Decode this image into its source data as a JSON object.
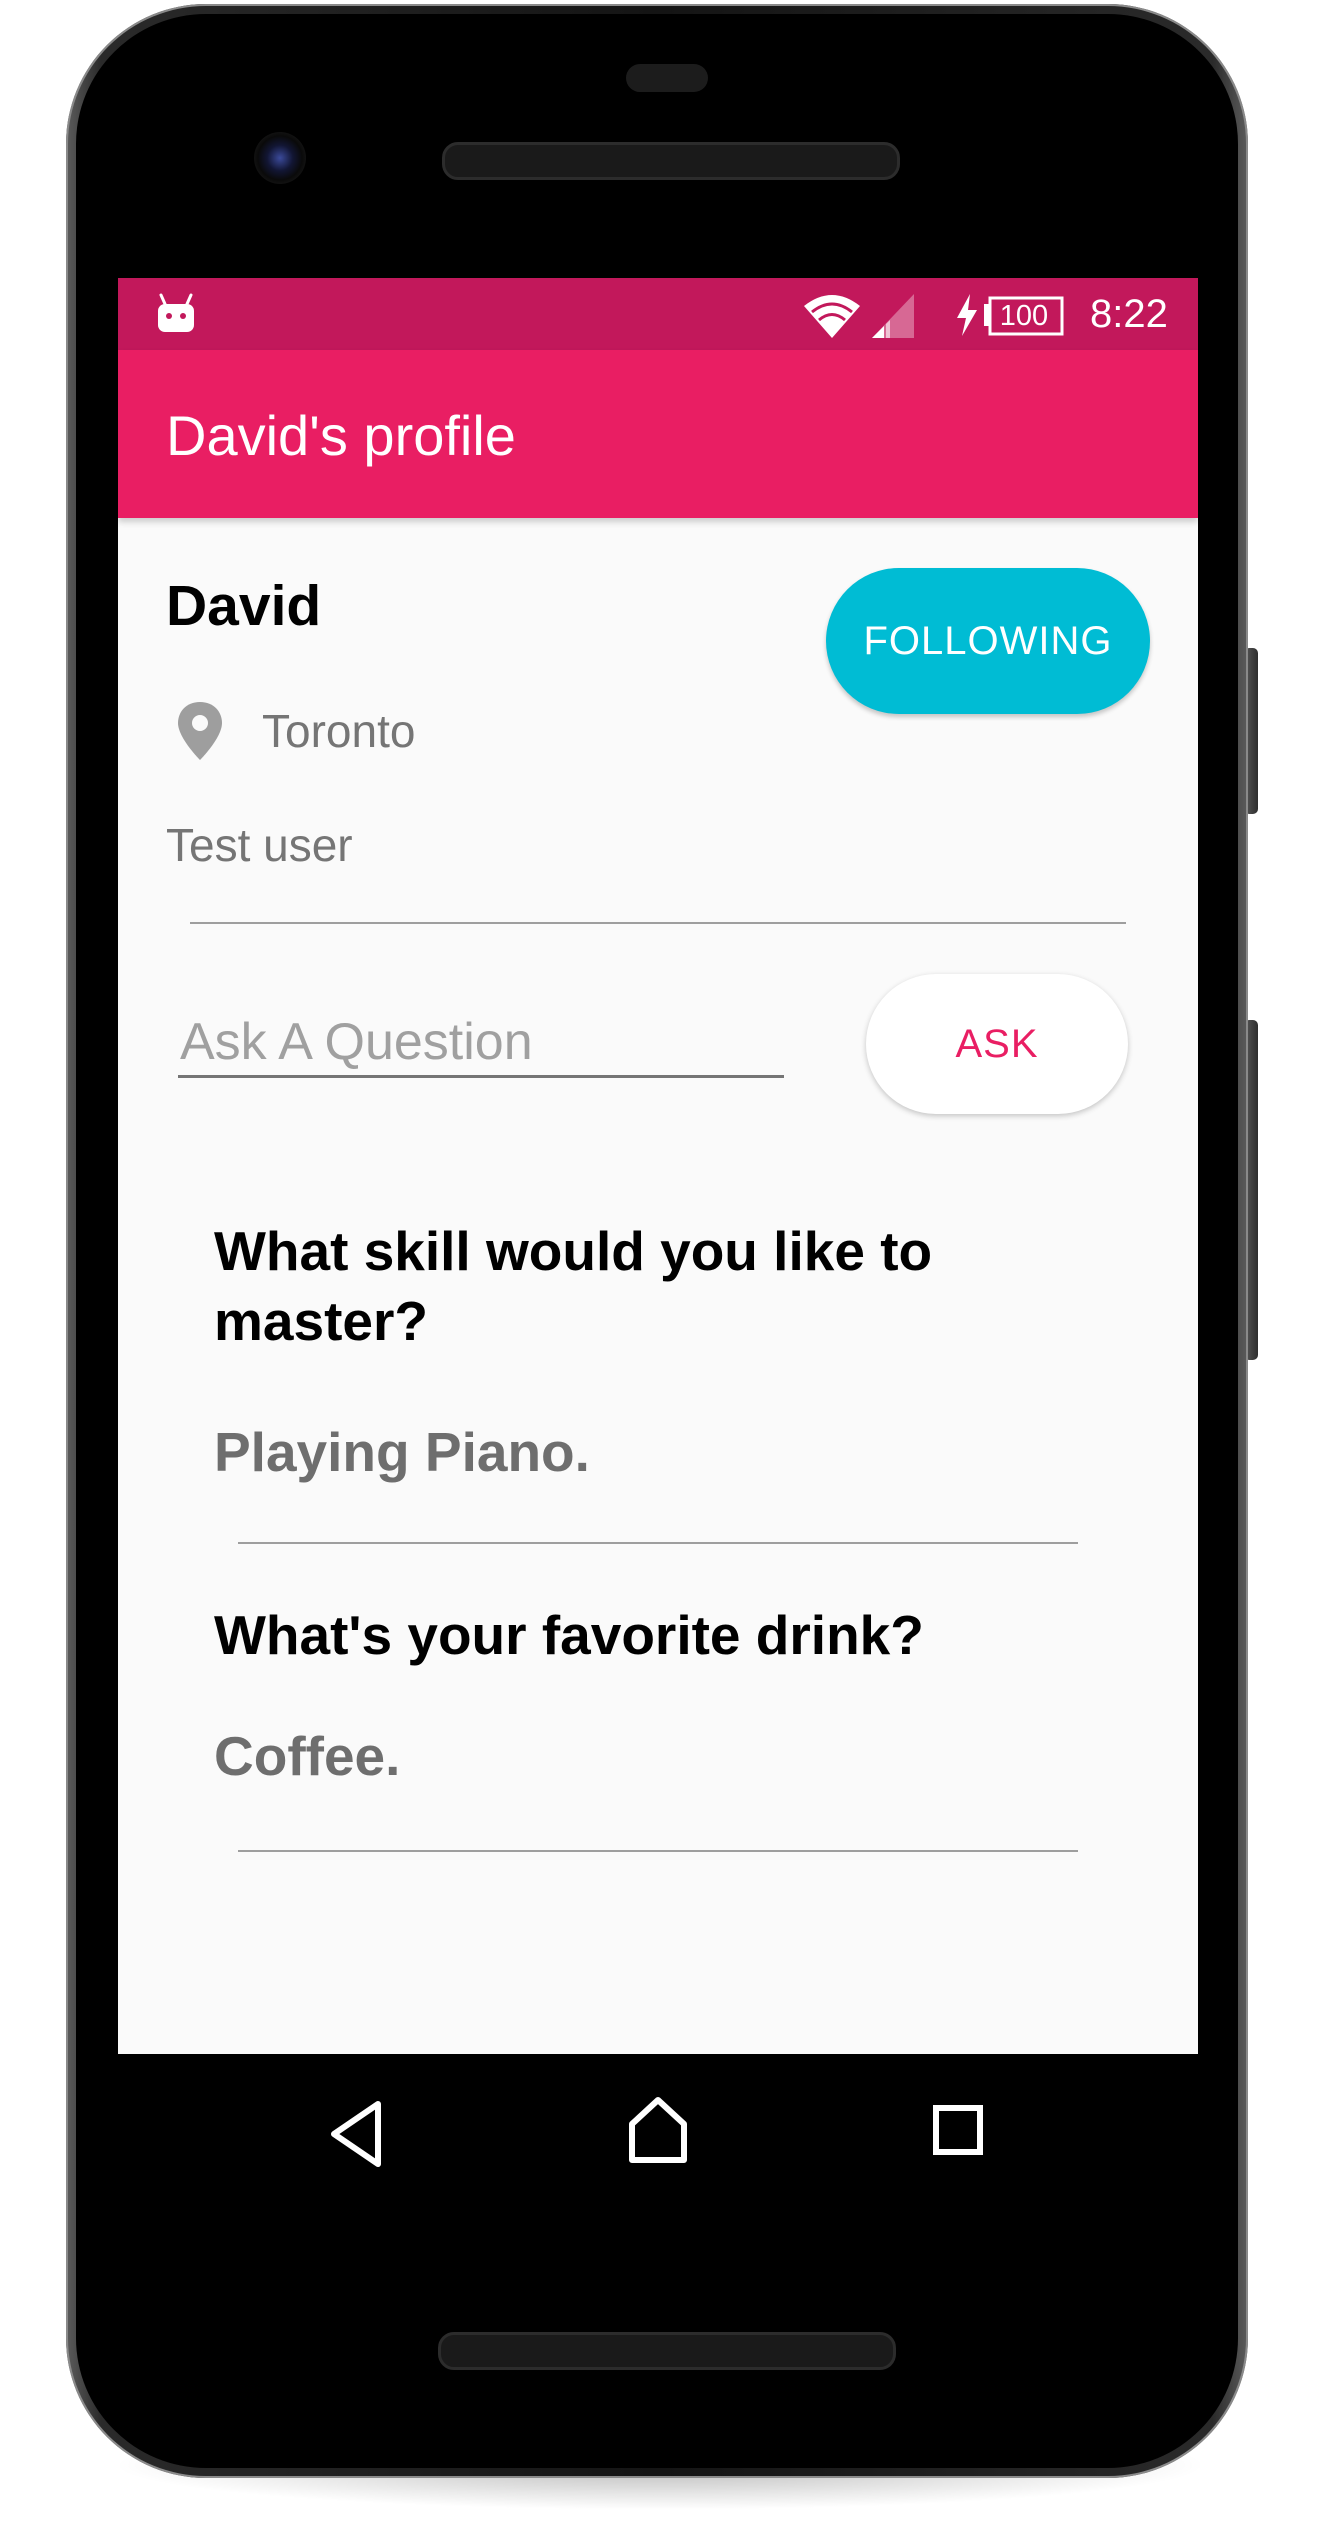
{
  "status_bar": {
    "battery_level": "100",
    "time": "8:22",
    "icons": [
      "android-icon",
      "wifi-icon",
      "signal-icon",
      "charging-icon",
      "battery-icon"
    ]
  },
  "app_bar": {
    "title": "David's profile"
  },
  "profile": {
    "name": "David",
    "location_icon": "location-pin-icon",
    "location": "Toronto",
    "bio": "Test user",
    "follow_button_label": "FOLLOWING"
  },
  "ask": {
    "placeholder": "Ask A Question",
    "value": "",
    "button_label": "ASK"
  },
  "questions": [
    {
      "question": "What skill would you like to master?",
      "answer": "Playing Piano."
    },
    {
      "question": "What's your favorite drink?",
      "answer": "Coffee."
    }
  ],
  "nav_bar": {
    "icons": [
      "back-icon",
      "home-icon",
      "recent-apps-icon"
    ]
  },
  "colors": {
    "status_bar": "#c2185b",
    "app_bar": "#e91e63",
    "follow_button": "#00bcd4",
    "ask_button_text": "#e91e63",
    "secondary_text": "#757575"
  }
}
